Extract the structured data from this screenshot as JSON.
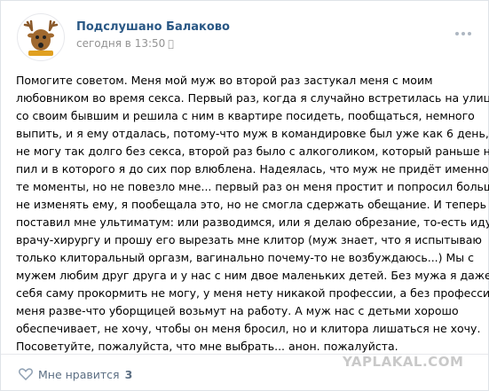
{
  "post": {
    "author": "Подслушано Балаково",
    "date": "сегодня в 13:50",
    "platform_icon": "apple-icon",
    "lines": [
      "Помогите советом. Меня мой муж во второй раз застукал меня с моим",
      "любовником во время секса. Первый раз, когда я случайно встретилась на улице",
      "со своим бывшим и решила с ним в квартире посидеть, пообщаться, немного",
      "выпить, и я ему отдалась, потому-что муж в командировке был уже как 6 день, а я",
      "не могу так долго без секса, второй раз было с алкоголиком, который раньше не",
      "пил и в которого я до сих пор влюблена. Надеялась, что муж не придёт именно в",
      "те моменты, но не повезло мне... первый раз он меня простит и попросил больше",
      "не изменять ему, я пообещала это, но не смогла сдержать обещание. И теперь он",
      "поставил мне ультиматум: или разводимся, или я делаю обрезание, то-есть иду к",
      "врачу-хирургу и прошу его вырезать мне клитор (муж знает, что я испытываю",
      "только клиторальный оргазм, вагинально почему-то не возбуждаюсь...) Мы с",
      "мужем любим друг друга и у нас с ним двое маленьких детей. Без мужа я даже",
      "себя саму прокормить не могу, у меня нету никакой профессии, а без профессии",
      "меня разве-что уборщицей возьмут на работу. А муж нас с детьми хорошо",
      "обеспечивает, не хочу, чтобы он меня бросил, но и клитора лишаться не хочу.",
      "Посоветуйте, пожалуйста, что мне выбрать... анон. пожалуйста."
    ]
  },
  "footer": {
    "like_label": "Мне нравится",
    "like_count": "3"
  },
  "watermark": "YAPLAKAL.COM",
  "colors": {
    "author": "#2a5885",
    "meta": "#939393",
    "like": "#5b6e83"
  }
}
